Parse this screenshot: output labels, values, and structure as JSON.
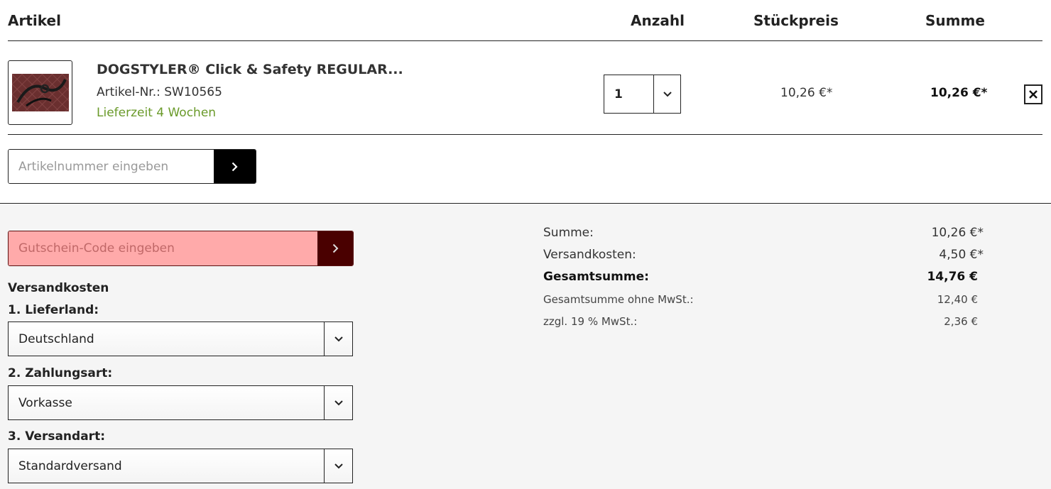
{
  "table_header": {
    "article": "Artikel",
    "quantity": "Anzahl",
    "unit_price": "Stückpreis",
    "total": "Summe"
  },
  "cart_item": {
    "title": "DOGSTYLER® Click & Safety REGULAR...",
    "sku": "Artikel-Nr.: SW10565",
    "delivery": "Lieferzeit 4 Wochen",
    "quantity": "1",
    "unit_price": "10,26 €*",
    "total": "10,26 €*"
  },
  "add_article": {
    "placeholder": "Artikelnummer eingeben"
  },
  "voucher": {
    "placeholder": "Gutschein-Code eingeben"
  },
  "shipping": {
    "title": "Versandkosten",
    "country_label": "1. Lieferland:",
    "country_value": "Deutschland",
    "payment_label": "2. Zahlungsart:",
    "payment_value": "Vorkasse",
    "method_label": "3. Versandart:",
    "method_value": "Standardversand"
  },
  "summary": {
    "subtotal_label": "Summe:",
    "subtotal_value": "10,26 €*",
    "shipping_label": "Versandkosten:",
    "shipping_value": "4,50 €*",
    "grand_total_label": "Gesamtsumme:",
    "grand_total_value": "14,76 €",
    "net_label": "Gesamtsumme ohne MwSt.:",
    "net_value": "12,40 €",
    "vat_label": "zzgl. 19 % MwSt.:",
    "vat_value": "2,36 €"
  },
  "colors": {
    "delivery_green": "#6a9a2a",
    "voucher_bg": "#ffaaaa",
    "voucher_button": "#4a0000"
  }
}
